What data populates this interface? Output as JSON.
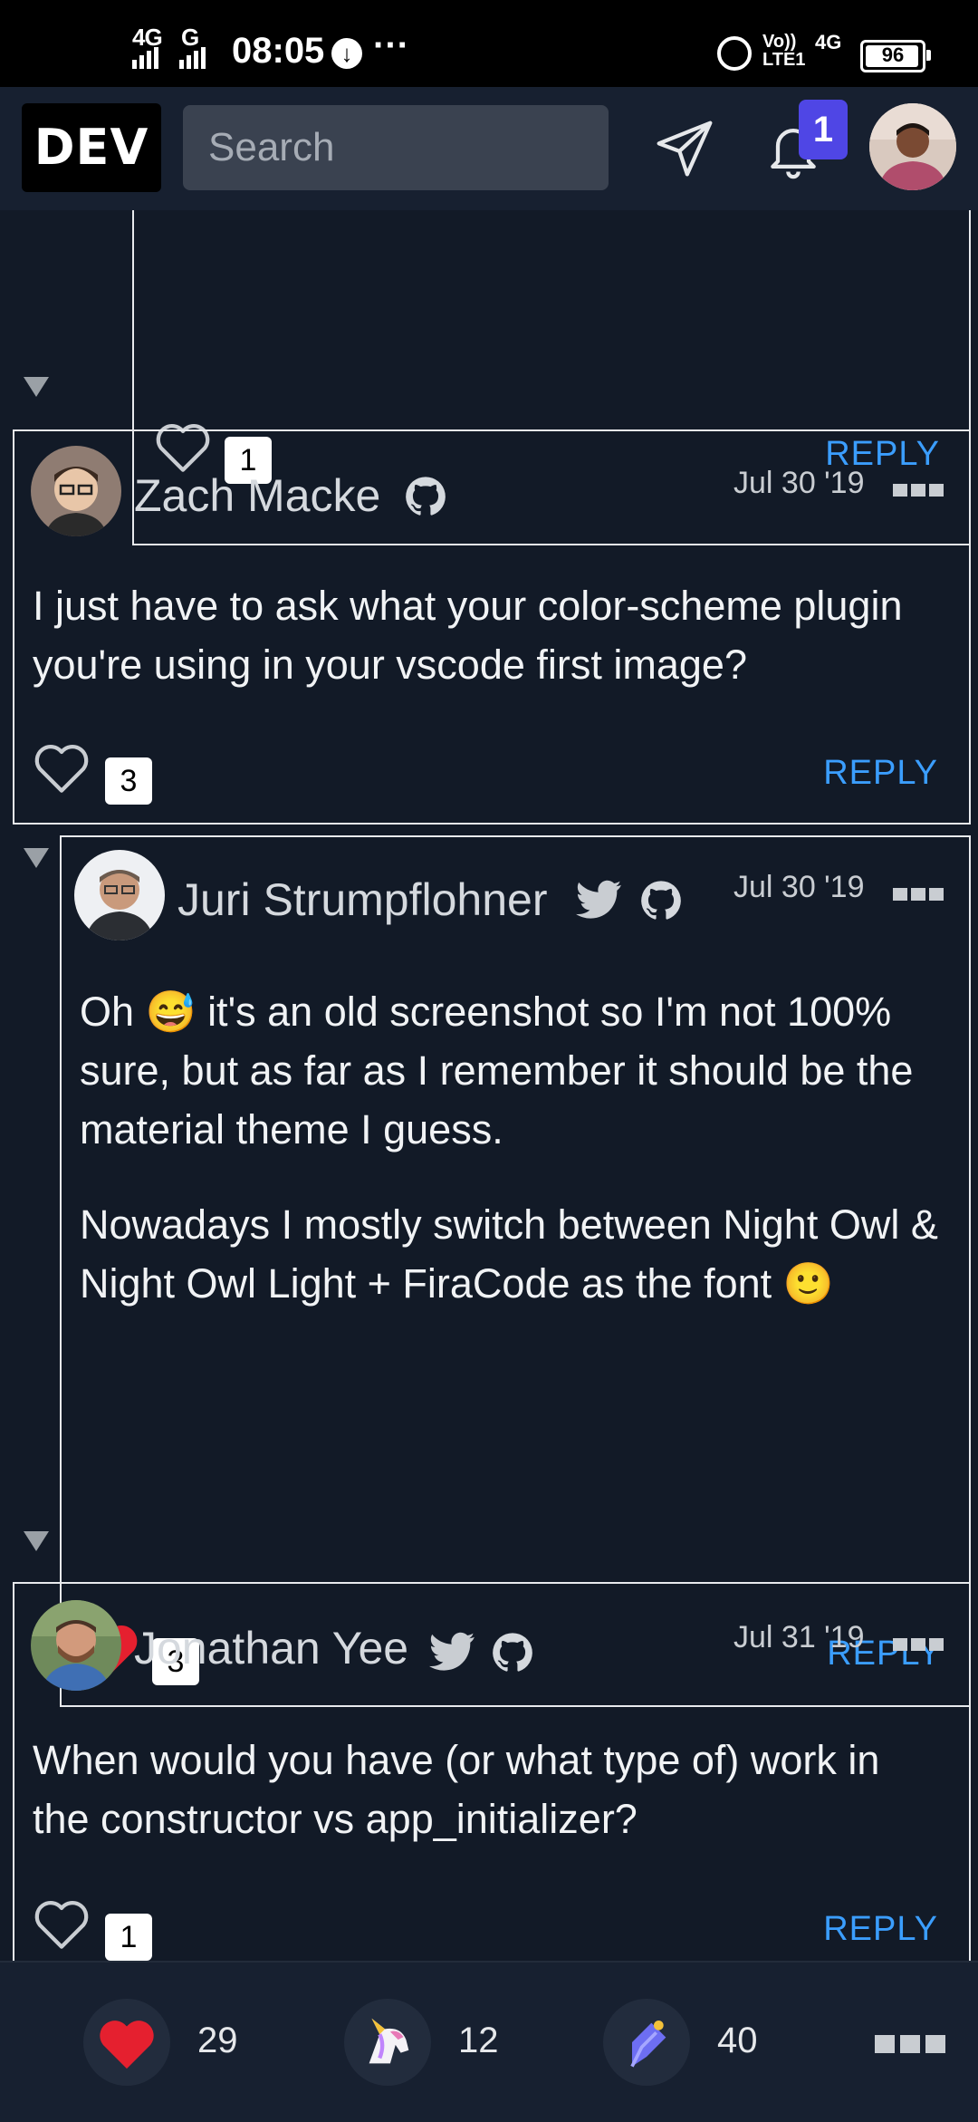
{
  "status_bar": {
    "network_left": "4G",
    "network_left_2": "G",
    "time": "08:05",
    "network_right_top": "Vo))",
    "network_right_bottom": "LTE1",
    "network_right_2": "4G",
    "battery": "96",
    "battery_level": 0.96
  },
  "nav": {
    "logo": "DEV",
    "search_placeholder": "Search",
    "notification_count": "1"
  },
  "thread": [
    {
      "id": "partial",
      "likes": "1",
      "liked": false,
      "reply_label": "REPLY"
    },
    {
      "id": "zach",
      "author": "Zach Macke",
      "date": "Jul 30 '19",
      "text": [
        "I just have to ask what your color-scheme plugin you're using in your vscode first image?"
      ],
      "likes": "3",
      "liked": false,
      "reply_label": "REPLY",
      "icons": [
        "github-icon"
      ]
    },
    {
      "id": "juri",
      "author": "Juri Strumpflohner",
      "date": "Jul 30 '19",
      "text": [
        "Oh 😅 it's an old screenshot so I'm not 100% sure, but as far as I remember it should be the material theme I guess.",
        "Nowadays I mostly switch between Night Owl & Night Owl Light + FiraCode as the font 🙂"
      ],
      "likes": "3",
      "liked": true,
      "reply_label": "REPLY",
      "icons": [
        "twitter-icon",
        "github-icon"
      ]
    },
    {
      "id": "jonathan",
      "author": "Jonathan Yee",
      "date": "Jul 31 '19",
      "text": [
        "When would you have (or what type of) work in the constructor vs app_initializer?"
      ],
      "likes": "1",
      "liked": false,
      "reply_label": "REPLY",
      "icons": [
        "twitter-icon",
        "github-icon"
      ]
    }
  ],
  "reactions": {
    "hearts": "29",
    "unicorns": "12",
    "bookmarks": "40"
  },
  "colors": {
    "background": "#121a27",
    "nav_background": "#172030",
    "accent": "#4f46e5",
    "reply_link": "#3b9eff",
    "liked_heart": "#e5202f"
  }
}
